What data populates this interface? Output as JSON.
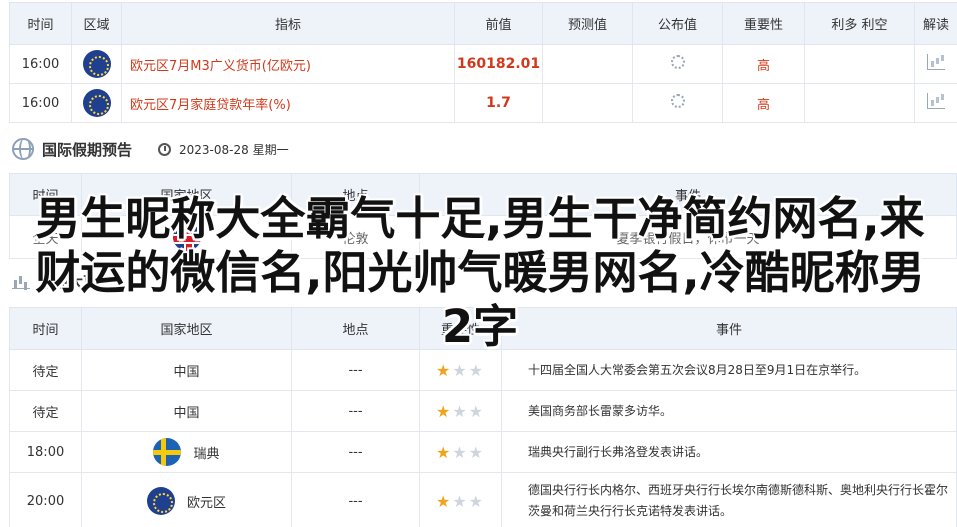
{
  "table1": {
    "headers": [
      "时间",
      "区域",
      "指标",
      "前值",
      "预测值",
      "公布值",
      "重要性",
      "利多 利空",
      "解读"
    ],
    "rows": [
      {
        "time": "16:00",
        "region_icon": "eu-flag-icon",
        "indicator": "欧元区7月M3广义货币(亿欧元)",
        "prev": "160182.01",
        "forecast": "",
        "actual_icon": "loading-icon",
        "importance": "高",
        "impact": "",
        "interpret_icon": "chart-icon"
      },
      {
        "time": "16:00",
        "region_icon": "eu-flag-icon",
        "indicator": "欧元区7月家庭贷款年率(%)",
        "prev": "1.7",
        "forecast": "",
        "actual_icon": "loading-icon",
        "importance": "高",
        "impact": "",
        "interpret_icon": "chart-icon"
      }
    ]
  },
  "holidays": {
    "title": "国际假期预告",
    "date": "2023-08-28 星期一",
    "headers": [
      "时间",
      "国家地区",
      "地点",
      "事件"
    ],
    "row": {
      "time": "全天",
      "region_icon": "uk-flag-icon",
      "place": "伦敦",
      "event": "夏季银行假日，休市一天"
    }
  },
  "events": {
    "title": "财经大事",
    "headers": [
      "时间",
      "国家地区",
      "地点",
      "重要性",
      "事件"
    ],
    "rows": [
      {
        "time": "待定",
        "country": "中国",
        "flag": "",
        "place": "---",
        "stars": 1,
        "event": "十四届全国人大常委会第五次会议8月28日至9月1日在京举行。"
      },
      {
        "time": "待定",
        "country": "中国",
        "flag": "",
        "place": "---",
        "stars": 1,
        "event": "美国商务部长雷蒙多访华。"
      },
      {
        "time": "18:00",
        "country": "瑞典",
        "flag": "se-flag-icon",
        "place": "---",
        "stars": 1,
        "event": "瑞典央行副行长弗洛登发表讲话。"
      },
      {
        "time": "20:00",
        "country": "欧元区",
        "flag": "eu-flag-icon",
        "place": "---",
        "stars": 1,
        "event": "德国央行行长内格尔、西班牙央行行长埃尔南德斯德科斯、奥地利央行行长霍尔茨曼和荷兰央行行长克诺特发表讲话。"
      }
    ]
  },
  "overlay_title": "男生昵称大全霸气十足,男生干净简约网名,来财运的微信名,阳光帅气暖男网名,冷酷昵称男2字"
}
